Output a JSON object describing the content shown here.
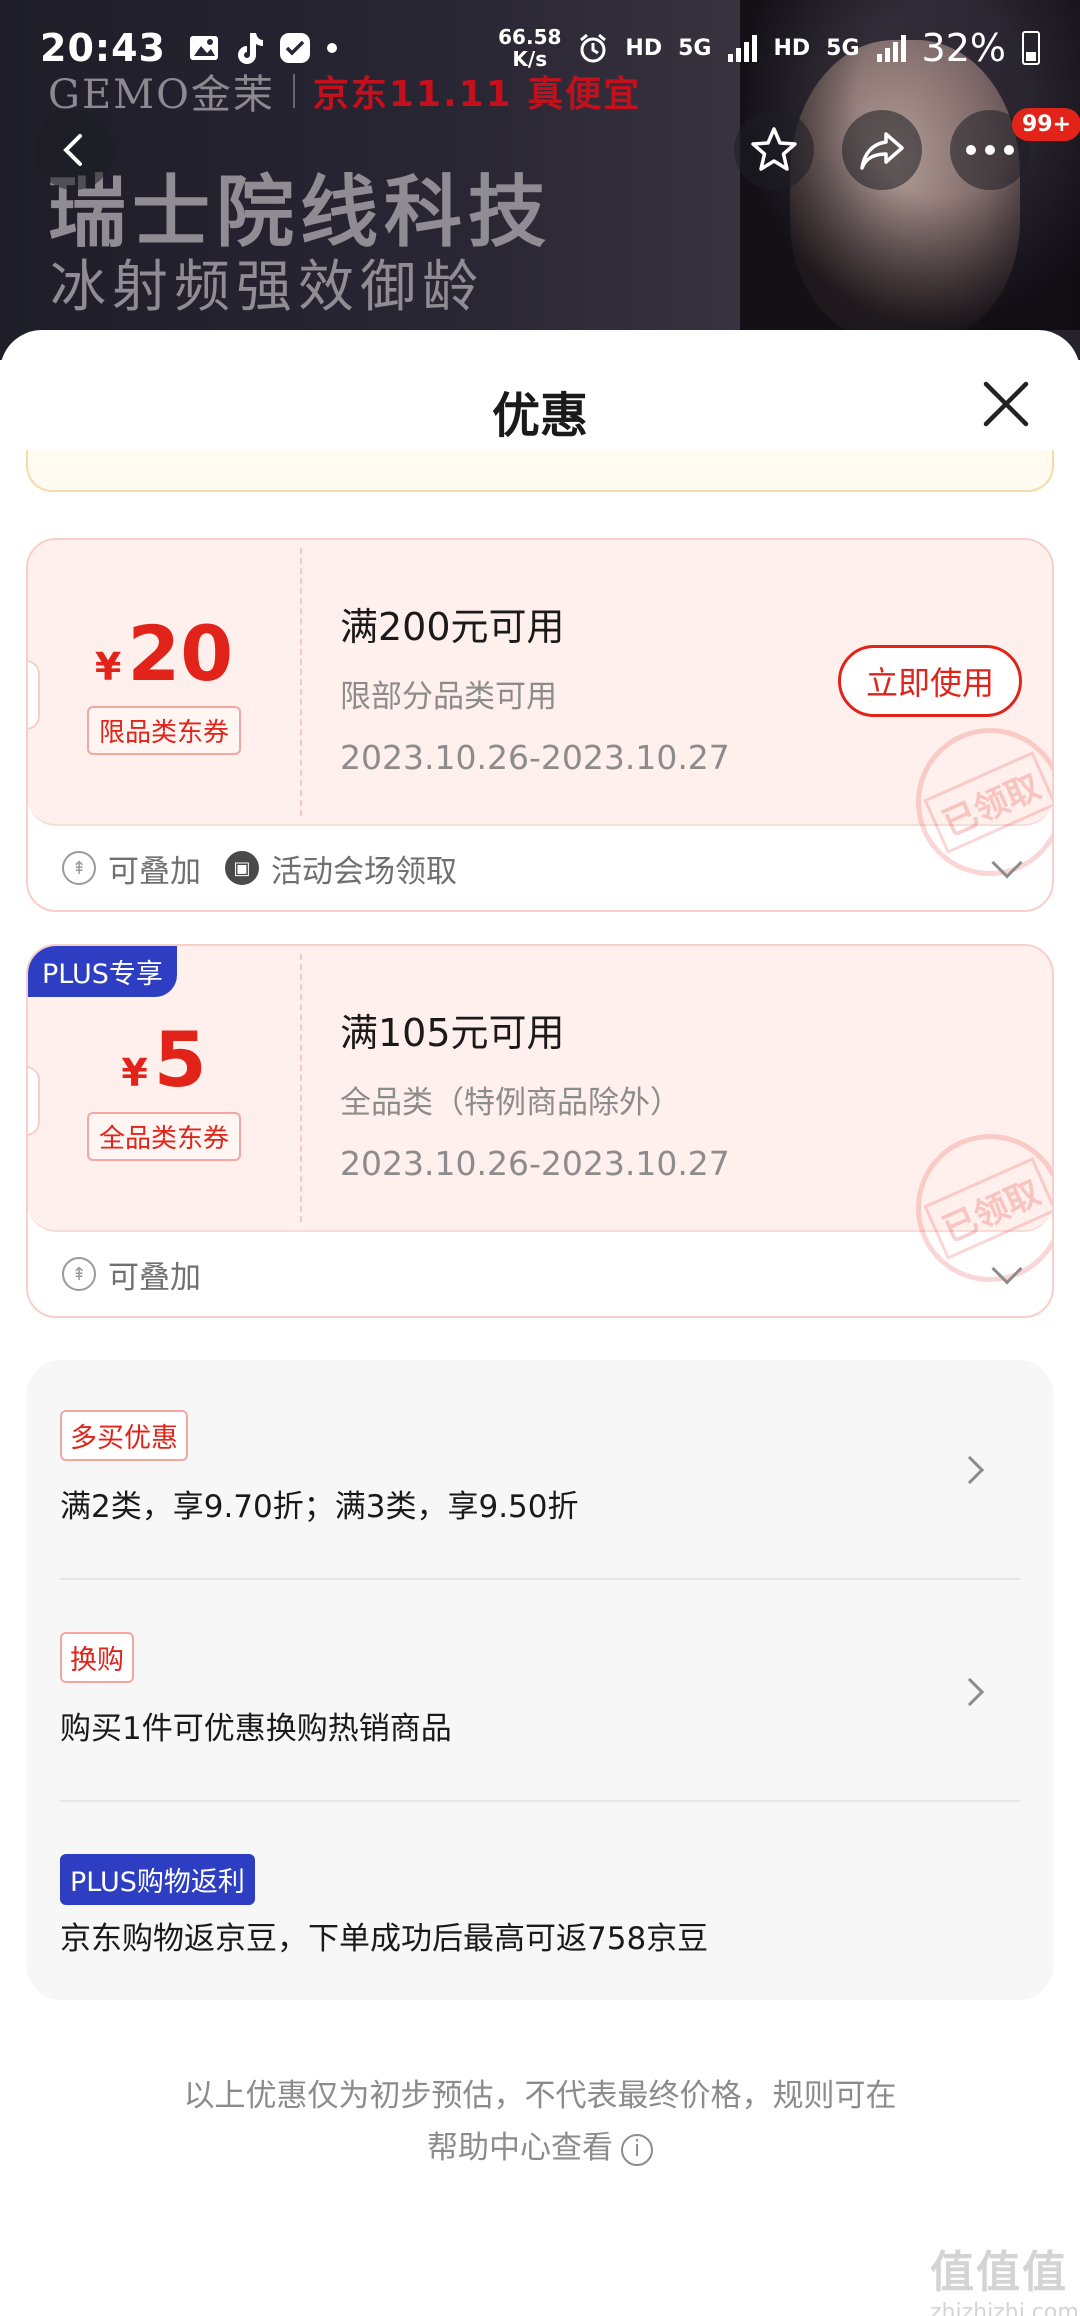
{
  "status_bar": {
    "time": "20:43",
    "net_speed_value": "66.58",
    "net_speed_unit": "K/s",
    "hd1": "HD",
    "fiveg1": "5G",
    "hd2": "HD",
    "fiveg2": "5G",
    "battery": "32%"
  },
  "hero": {
    "brand": "GEMO金茉",
    "promo": "京东11.11 真便宜",
    "headline": "瑞士院线科技",
    "subline": "冰射频强效御龄",
    "cart_badge": "99+"
  },
  "sheet": {
    "title": "优惠"
  },
  "coupons": [
    {
      "currency": "¥",
      "amount": "20",
      "type_tag": "限品类东券",
      "condition": "满200元可用",
      "scope": "限部分品类可用",
      "date": "2023.10.26-2023.10.27",
      "button": "立即使用",
      "stamp": "已领取",
      "stackable": "可叠加",
      "source": "活动会场领取"
    },
    {
      "plus_tag": "PLUS专享",
      "currency": "¥",
      "amount": "5",
      "type_tag": "全品类东券",
      "condition": "满105元可用",
      "scope": "全品类（特例商品除外）",
      "date": "2023.10.26-2023.10.27",
      "stamp": "已领取",
      "stackable": "可叠加"
    }
  ],
  "promos": [
    {
      "tag": "多买优惠",
      "text": "满2类，享9.70折；满3类，享9.50折"
    },
    {
      "tag": "换购",
      "text": "购买1件可优惠换购热销商品"
    },
    {
      "tag": "PLUS购物返利",
      "text": "京东购物返京豆，下单成功后最高可返758京豆"
    }
  ],
  "footnote": {
    "line1": "以上优惠仅为初步预估，不代表最终价格，规则可在",
    "line2": "帮助中心查看"
  },
  "watermark": {
    "big": "值值值",
    "small": "zhizhizhi.com"
  }
}
